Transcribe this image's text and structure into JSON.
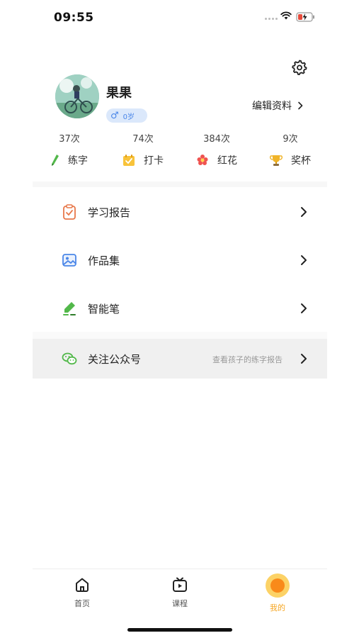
{
  "status_bar": {
    "time": "09:55",
    "icons": [
      "signal-icon",
      "wifi-icon",
      "battery-charging-icon"
    ]
  },
  "profile": {
    "name": "果果",
    "gender_symbol": "♂",
    "age": "0岁",
    "edit_label": "编辑资料",
    "avatar_icon": "avatar-image"
  },
  "stats": [
    {
      "count": "37次",
      "label": "练字",
      "icon": "pencil-icon"
    },
    {
      "count": "74次",
      "label": "打卡",
      "icon": "calendar-check-icon"
    },
    {
      "count": "384次",
      "label": "红花",
      "icon": "red-flower-icon"
    },
    {
      "count": "9次",
      "label": "奖杯",
      "icon": "trophy-icon"
    }
  ],
  "menu": [
    {
      "label": "学习报告",
      "icon": "report-clipboard-icon"
    },
    {
      "label": "作品集",
      "icon": "gallery-icon"
    },
    {
      "label": "智能笔",
      "icon": "smart-pen-icon"
    }
  ],
  "wechat": {
    "label": "关注公众号",
    "hint": "查看孩子的练字报告",
    "icon": "wechat-icon"
  },
  "tabbar": {
    "items": [
      {
        "label": "首页",
        "icon": "home-icon"
      },
      {
        "label": "课程",
        "icon": "tv-play-icon"
      },
      {
        "label": "我的",
        "icon": "me-icon"
      }
    ],
    "active": "我的"
  },
  "colors": {
    "accent": "#f5a623",
    "badge_bg": "#dbe8fb",
    "badge_text": "#4a86e8",
    "report_icon": "#e8784a",
    "gallery_icon": "#4a86e8",
    "pen_icon": "#52b84a",
    "wechat_icon": "#52b84a"
  }
}
